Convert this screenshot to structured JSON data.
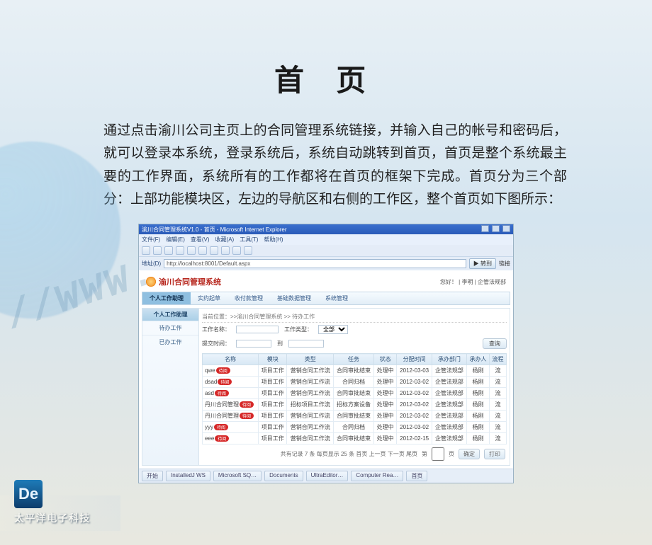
{
  "slide": {
    "title": "首  页",
    "body": "通过点击渝川公司主页上的合同管理系统链接，并输入自己的帐号和密码后，就可以登录本系统，登录系统后，系统自动跳转到首页，首页是整个系统最主要的工作界面，系统所有的工作都将在首页的框架下完成。首页分为三个部分：上部功能模块区，左边的导航区和右侧的工作区，整个首页如下图所示："
  },
  "ie": {
    "title": "渝川合同管理系统V1.0 - 首页 - Microsoft Internet Explorer",
    "menus": [
      "文件(F)",
      "编辑(E)",
      "查看(V)",
      "收藏(A)",
      "工具(T)",
      "帮助(H)"
    ],
    "addr_label": "地址(D)",
    "addr_value": "http://localhost:8001/Default.aspx",
    "go_label": "转到",
    "links_label": "链接",
    "close_tip": "关闭"
  },
  "app": {
    "sys_name": "渝川合同管理系统",
    "user_info": "您好！  | 李明 | 企管法规部",
    "tabs": [
      "个人工作助理",
      "实约起草",
      "收付款管理",
      "基础数据管理",
      "系统管理"
    ],
    "active_tab": 0,
    "sidebar": {
      "header": "个人工作助理",
      "items": [
        "待办工作",
        "已办工作"
      ]
    },
    "crumb": "当前位置：>>渝川合同管理系统 >> 待办工作",
    "filters": {
      "name_lbl": "工作名称：",
      "time_lbl": "提交时间：",
      "type_lbl": "工作类型：",
      "type_val": "全部",
      "to_sep": "到",
      "search_btn": "查询"
    },
    "table_headers": [
      "名称",
      "模块",
      "类型",
      "任务",
      "状态",
      "分配时间",
      "承办部门",
      "承办人",
      "流程"
    ],
    "rows": [
      {
        "name": "qwe",
        "mod": "项目工作",
        "type": "营销合同工作流",
        "task": "合同审批结束",
        "stat": "处理中",
        "time": "2012-03-03",
        "dept": "企管法规部",
        "person": "杨刚"
      },
      {
        "name": "dsad",
        "mod": "项目工作",
        "type": "营销合同工作流",
        "task": "合同归档",
        "stat": "处理中",
        "time": "2012-03-02",
        "dept": "企管法规部",
        "person": "杨刚"
      },
      {
        "name": "asd",
        "mod": "项目工作",
        "type": "营销合同工作流",
        "task": "合同审批结束",
        "stat": "处理中",
        "time": "2012-03-02",
        "dept": "企管法规部",
        "person": "杨刚"
      },
      {
        "name": "丹川合同管理",
        "mod": "项目工作",
        "type": "招标项目工作流",
        "task": "招标方案设备",
        "stat": "处理中",
        "time": "2012-03-02",
        "dept": "企管法规部",
        "person": "杨刚"
      },
      {
        "name": "丹川合同管理",
        "mod": "项目工作",
        "type": "营销合同工作流",
        "task": "合同审批结束",
        "stat": "处理中",
        "time": "2012-03-02",
        "dept": "企管法规部",
        "person": "杨刚"
      },
      {
        "name": "yyy",
        "mod": "项目工作",
        "type": "营销合同工作流",
        "task": "合同归档",
        "stat": "处理中",
        "time": "2012-03-02",
        "dept": "企管法规部",
        "person": "杨刚"
      },
      {
        "name": "eee",
        "mod": "项目工作",
        "type": "营销合同工作流",
        "task": "合同审批结束",
        "stat": "处理中",
        "time": "2012-02-15",
        "dept": "企管法规部",
        "person": "杨刚"
      }
    ],
    "flow_cell": "流",
    "pill": "待阅",
    "pager": {
      "text": "共有记录 7 条 每页显示 25 条 首页 上一页 下一页 尾页",
      "goto_lbl": "第",
      "page_lbl": "页",
      "ok_btn": "确定",
      "print_btn": "打印"
    }
  },
  "taskbar": [
    "开始",
    "InstalledJ WS",
    "Microsoft SQ…",
    "Documents",
    "UltraEditor…",
    "Computer Rea…",
    "首页"
  ],
  "footer": {
    "brand_mark": "De",
    "brand_text": "太平洋电子科技"
  },
  "decor": {
    "www": "://WWW."
  }
}
